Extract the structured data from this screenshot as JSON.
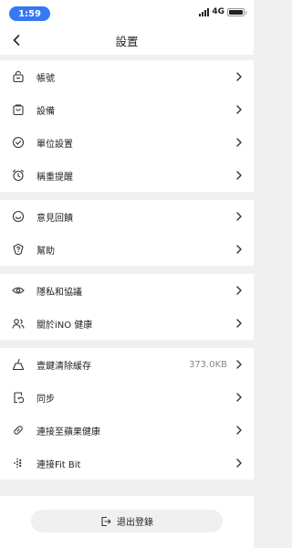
{
  "status_bar": {
    "time": "1:59",
    "network": "4G"
  },
  "nav": {
    "title": "設置"
  },
  "groups": [
    {
      "items": [
        {
          "label": "帳號",
          "icon": "lock-icon"
        },
        {
          "label": "設備",
          "icon": "bag-icon"
        },
        {
          "label": "單位設置",
          "icon": "check-circle-icon"
        },
        {
          "label": "稱重提醒",
          "icon": "alarm-clock-icon"
        }
      ]
    },
    {
      "items": [
        {
          "label": "意見回饋",
          "icon": "smile-icon"
        },
        {
          "label": "幫助",
          "icon": "shield-question-icon"
        }
      ]
    },
    {
      "items": [
        {
          "label": "隱私和協議",
          "icon": "eye-icon"
        },
        {
          "label": "關於iNO 健康",
          "icon": "users-icon"
        }
      ]
    },
    {
      "items": [
        {
          "label": "壹鍵清除緩存",
          "icon": "broom-icon",
          "value": "373.0KB"
        },
        {
          "label": "同步",
          "icon": "sync-icon"
        },
        {
          "label": "連接至蘋果健康",
          "icon": "link-icon"
        },
        {
          "label": "連接Fit Bit",
          "icon": "fitbit-icon"
        }
      ]
    }
  ],
  "logout": {
    "label": "退出登錄",
    "icon": "logout-icon"
  }
}
